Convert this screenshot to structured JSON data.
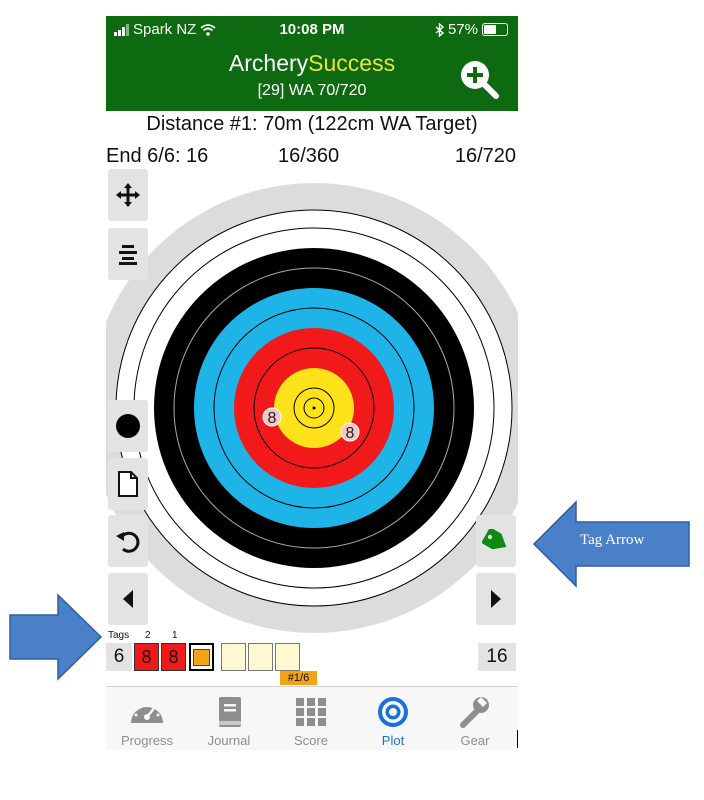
{
  "status_bar": {
    "carrier": "Spark NZ",
    "time": "10:08 PM",
    "battery": "57%"
  },
  "header": {
    "brand_part1": "Archery",
    "brand_part2": "Success",
    "subtitle": "[29] WA 70/720"
  },
  "distance_line": "Distance #1: 70m (122cm WA Target)",
  "end_row": {
    "end": "End 6/6: 16",
    "middle": "16/360",
    "right": "16/720"
  },
  "target": {
    "ring_colors": {
      "white": "#ffffff",
      "black": "#000000",
      "blue": "#1fb4e8",
      "red": "#f11919",
      "gold": "#ffe21a"
    },
    "arrow_labels": [
      "8",
      "8"
    ]
  },
  "tags_row": {
    "tags_label": "Tags",
    "tag_numbers": [
      "2",
      "1"
    ],
    "count": "6",
    "arrow_scores": [
      "8",
      "8"
    ],
    "end_total": "16",
    "end_tag": "#1/6"
  },
  "tabs": [
    {
      "label": "Progress",
      "icon": "gauge-icon"
    },
    {
      "label": "Journal",
      "icon": "book-icon"
    },
    {
      "label": "Score",
      "icon": "grid-icon"
    },
    {
      "label": "Plot",
      "icon": "target-icon"
    },
    {
      "label": "Gear",
      "icon": "wrench-icon"
    }
  ],
  "callouts": {
    "tag_arrow": "Tag Arrow"
  },
  "colors": {
    "header_green": "#0d6a10",
    "brand_yellow": "#e8e23a",
    "active_tab": "#1a72d8",
    "callout_blue": "#4a80c8",
    "tag_green": "#0d8a14"
  }
}
